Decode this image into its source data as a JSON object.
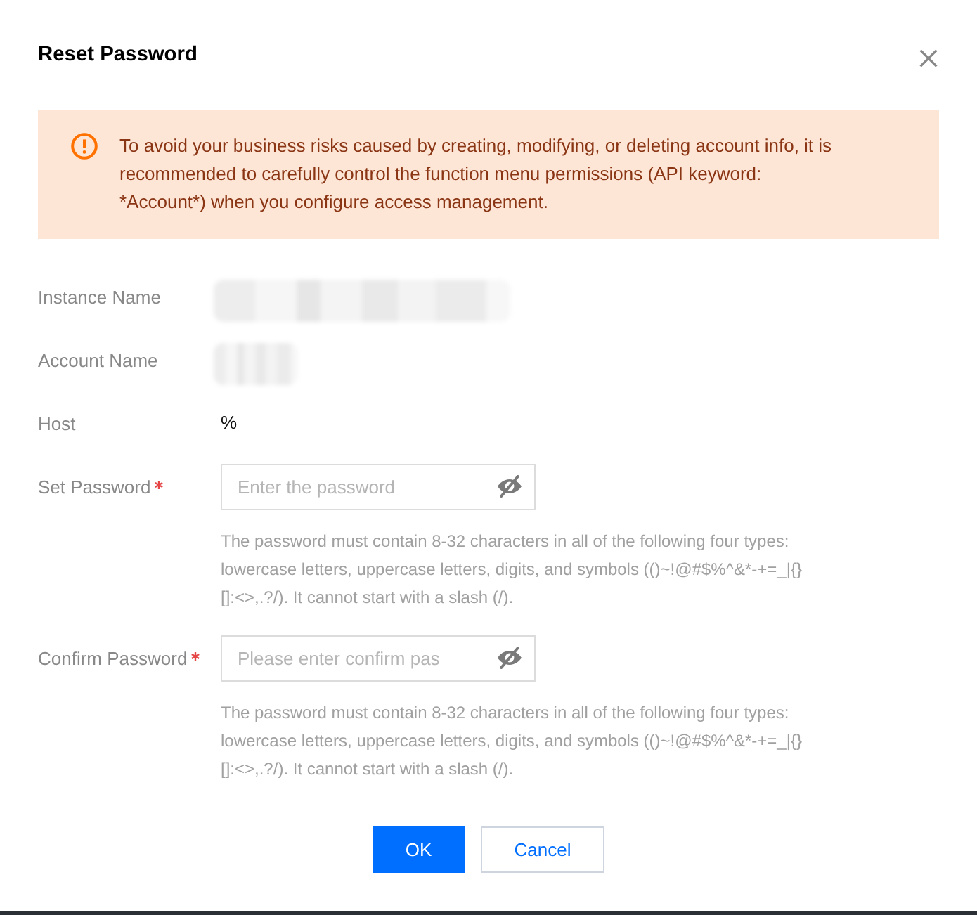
{
  "dialog": {
    "title": "Reset Password"
  },
  "alert": {
    "message": "To avoid your business risks caused by creating, modifying, or deleting account info, it is recommended to carefully control the function menu permissions (API keyword: *Account*) when you configure access management."
  },
  "fields": [
    {
      "kind": "redacted",
      "label": "Instance Name"
    },
    {
      "kind": "redacted",
      "label": "Account Name"
    },
    {
      "kind": "text",
      "label": "Host",
      "value": "%"
    },
    {
      "kind": "password",
      "label": "Set Password",
      "required": true,
      "placeholder": "Enter the password",
      "hint": "The password must contain 8-32 characters in all of the following four types: lowercase letters, uppercase letters, digits, and symbols (()~!@#$%^&*-+=_|{}[]:<>,.?/). It cannot start with a slash (/)."
    },
    {
      "kind": "password",
      "label": "Confirm Password",
      "required": true,
      "placeholder": "Please enter confirm pas",
      "hint": "The password must contain 8-32 characters in all of the following four types: lowercase letters, uppercase letters, digits, and symbols (()~!@#$%^&*-+=_|{}[]:<>,.?/). It cannot start with a slash (/)."
    }
  ],
  "buttons": [
    {
      "kind": "primary",
      "label": "OK"
    },
    {
      "kind": "secondary",
      "label": "Cancel"
    }
  ]
}
